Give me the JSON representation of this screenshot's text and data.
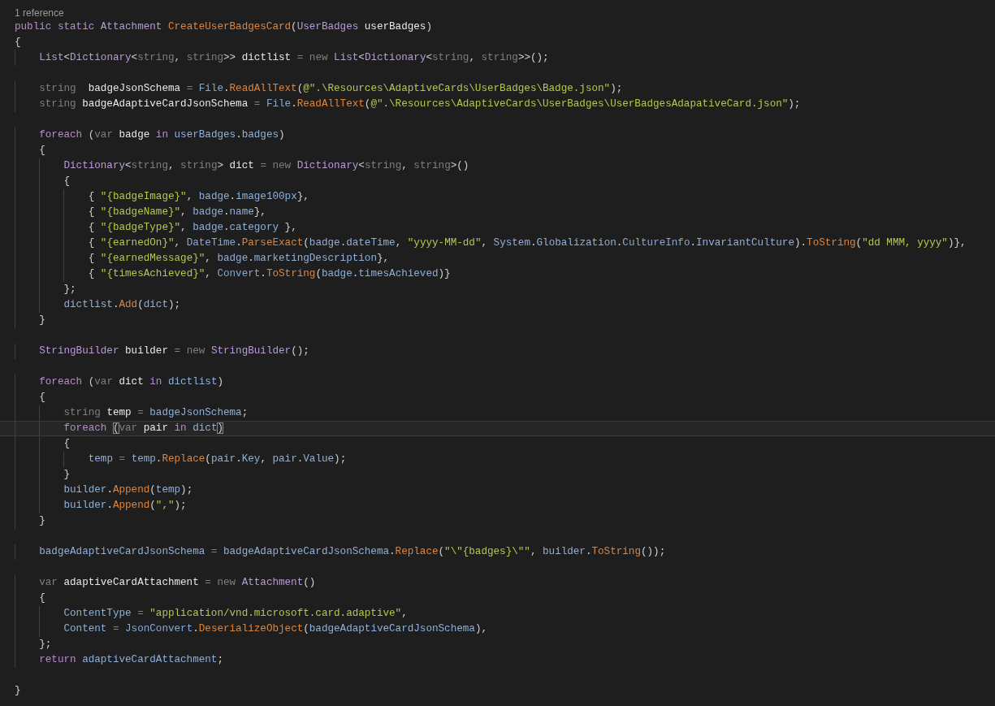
{
  "codelens": "1 reference",
  "lines": [
    {
      "kind": "code",
      "current": false,
      "tokens": [
        {
          "kind": "keyword",
          "text": "public static "
        },
        {
          "kind": "type",
          "text": "Attachment "
        },
        {
          "kind": "method",
          "text": "CreateUserBadgesCard"
        },
        {
          "kind": "punct",
          "text": "("
        },
        {
          "kind": "type",
          "text": "UserBadges "
        },
        {
          "kind": "local",
          "text": "userBadges"
        },
        {
          "kind": "punct",
          "text": ")"
        }
      ]
    },
    {
      "kind": "code",
      "current": false,
      "tokens": [
        {
          "kind": "punct",
          "text": "{"
        }
      ]
    },
    {
      "kind": "code",
      "current": false,
      "tokens": [
        {
          "kind": "type",
          "text": "    List"
        },
        {
          "kind": "punct",
          "text": "<"
        },
        {
          "kind": "type",
          "text": "Dictionary"
        },
        {
          "kind": "punct",
          "text": "<"
        },
        {
          "kind": "dim",
          "text": "string"
        },
        {
          "kind": "punct",
          "text": ", "
        },
        {
          "kind": "dim",
          "text": "string"
        },
        {
          "kind": "punct",
          "text": ">> "
        },
        {
          "kind": "local",
          "text": "dictlist "
        },
        {
          "kind": "dim",
          "text": "= new "
        },
        {
          "kind": "type",
          "text": "List"
        },
        {
          "kind": "punct",
          "text": "<"
        },
        {
          "kind": "type",
          "text": "Dictionary"
        },
        {
          "kind": "punct",
          "text": "<"
        },
        {
          "kind": "dim",
          "text": "string"
        },
        {
          "kind": "punct",
          "text": ", "
        },
        {
          "kind": "dim",
          "text": "string"
        },
        {
          "kind": "punct",
          "text": ">>();"
        }
      ]
    },
    {
      "kind": "blank"
    },
    {
      "kind": "code",
      "current": false,
      "tokens": [
        {
          "kind": "dim",
          "text": "    string  "
        },
        {
          "kind": "local",
          "text": "badgeJsonSchema "
        },
        {
          "kind": "dim",
          "text": "= "
        },
        {
          "kind": "class",
          "text": "File"
        },
        {
          "kind": "punct",
          "text": "."
        },
        {
          "kind": "method",
          "text": "ReadAllText"
        },
        {
          "kind": "punct",
          "text": "("
        },
        {
          "kind": "string",
          "text": "@\".\\Resources\\AdaptiveCards\\UserBadges\\Badge.json\""
        },
        {
          "kind": "punct",
          "text": ");"
        }
      ]
    },
    {
      "kind": "code",
      "current": false,
      "tokens": [
        {
          "kind": "dim",
          "text": "    string "
        },
        {
          "kind": "local",
          "text": "badgeAdaptiveCardJsonSchema "
        },
        {
          "kind": "dim",
          "text": "= "
        },
        {
          "kind": "class",
          "text": "File"
        },
        {
          "kind": "punct",
          "text": "."
        },
        {
          "kind": "method",
          "text": "ReadAllText"
        },
        {
          "kind": "punct",
          "text": "("
        },
        {
          "kind": "string",
          "text": "@\".\\Resources\\AdaptiveCards\\UserBadges\\UserBadgesAdapativeCard.json\""
        },
        {
          "kind": "punct",
          "text": ");"
        }
      ]
    },
    {
      "kind": "blank"
    },
    {
      "kind": "code",
      "current": false,
      "tokens": [
        {
          "kind": "keyword",
          "text": "    foreach "
        },
        {
          "kind": "punct",
          "text": "("
        },
        {
          "kind": "dim",
          "text": "var "
        },
        {
          "kind": "local",
          "text": "badge "
        },
        {
          "kind": "keyword",
          "text": "in "
        },
        {
          "kind": "member",
          "text": "userBadges"
        },
        {
          "kind": "punct",
          "text": "."
        },
        {
          "kind": "member",
          "text": "badges"
        },
        {
          "kind": "punct",
          "text": ")"
        }
      ]
    },
    {
      "kind": "code",
      "current": false,
      "tokens": [
        {
          "kind": "punct",
          "text": "    {"
        }
      ]
    },
    {
      "kind": "code",
      "current": false,
      "tokens": [
        {
          "kind": "type",
          "text": "        Dictionary"
        },
        {
          "kind": "punct",
          "text": "<"
        },
        {
          "kind": "dim",
          "text": "string"
        },
        {
          "kind": "punct",
          "text": ", "
        },
        {
          "kind": "dim",
          "text": "string"
        },
        {
          "kind": "punct",
          "text": "> "
        },
        {
          "kind": "local",
          "text": "dict "
        },
        {
          "kind": "dim",
          "text": "= new "
        },
        {
          "kind": "type",
          "text": "Dictionary"
        },
        {
          "kind": "punct",
          "text": "<"
        },
        {
          "kind": "dim",
          "text": "string"
        },
        {
          "kind": "punct",
          "text": ", "
        },
        {
          "kind": "dim",
          "text": "string"
        },
        {
          "kind": "punct",
          "text": ">()"
        }
      ]
    },
    {
      "kind": "code",
      "current": false,
      "tokens": [
        {
          "kind": "punct",
          "text": "        {"
        }
      ]
    },
    {
      "kind": "code",
      "current": false,
      "tokens": [
        {
          "kind": "punct",
          "text": "            { "
        },
        {
          "kind": "string",
          "text": "\"{badgeImage}\""
        },
        {
          "kind": "punct",
          "text": ", "
        },
        {
          "kind": "member",
          "text": "badge"
        },
        {
          "kind": "punct",
          "text": "."
        },
        {
          "kind": "member",
          "text": "image100px"
        },
        {
          "kind": "punct",
          "text": "},"
        }
      ]
    },
    {
      "kind": "code",
      "current": false,
      "tokens": [
        {
          "kind": "punct",
          "text": "            { "
        },
        {
          "kind": "string",
          "text": "\"{badgeName}\""
        },
        {
          "kind": "punct",
          "text": ", "
        },
        {
          "kind": "member",
          "text": "badge"
        },
        {
          "kind": "punct",
          "text": "."
        },
        {
          "kind": "member",
          "text": "name"
        },
        {
          "kind": "punct",
          "text": "},"
        }
      ]
    },
    {
      "kind": "code",
      "current": false,
      "tokens": [
        {
          "kind": "punct",
          "text": "            { "
        },
        {
          "kind": "string",
          "text": "\"{badgeType}\""
        },
        {
          "kind": "punct",
          "text": ", "
        },
        {
          "kind": "member",
          "text": "badge"
        },
        {
          "kind": "punct",
          "text": "."
        },
        {
          "kind": "member",
          "text": "category "
        },
        {
          "kind": "punct",
          "text": "},"
        }
      ]
    },
    {
      "kind": "code",
      "current": false,
      "tokens": [
        {
          "kind": "punct",
          "text": "            { "
        },
        {
          "kind": "string",
          "text": "\"{earnedOn}\""
        },
        {
          "kind": "punct",
          "text": ", "
        },
        {
          "kind": "class",
          "text": "DateTime"
        },
        {
          "kind": "punct",
          "text": "."
        },
        {
          "kind": "method",
          "text": "ParseExact"
        },
        {
          "kind": "punct",
          "text": "("
        },
        {
          "kind": "member",
          "text": "badge"
        },
        {
          "kind": "punct",
          "text": "."
        },
        {
          "kind": "member",
          "text": "dateTime"
        },
        {
          "kind": "punct",
          "text": ", "
        },
        {
          "kind": "string",
          "text": "\"yyyy-MM-dd\""
        },
        {
          "kind": "punct",
          "text": ", "
        },
        {
          "kind": "member",
          "text": "System"
        },
        {
          "kind": "punct",
          "text": "."
        },
        {
          "kind": "member",
          "text": "Globalization"
        },
        {
          "kind": "punct",
          "text": "."
        },
        {
          "kind": "class",
          "text": "CultureInfo"
        },
        {
          "kind": "punct",
          "text": "."
        },
        {
          "kind": "member",
          "text": "InvariantCulture"
        },
        {
          "kind": "punct",
          "text": ")."
        },
        {
          "kind": "method",
          "text": "ToString"
        },
        {
          "kind": "punct",
          "text": "("
        },
        {
          "kind": "string",
          "text": "\"dd MMM, yyyy\""
        },
        {
          "kind": "punct",
          "text": ")},"
        }
      ]
    },
    {
      "kind": "code",
      "current": false,
      "tokens": [
        {
          "kind": "punct",
          "text": "            { "
        },
        {
          "kind": "string",
          "text": "\"{earnedMessage}\""
        },
        {
          "kind": "punct",
          "text": ", "
        },
        {
          "kind": "member",
          "text": "badge"
        },
        {
          "kind": "punct",
          "text": "."
        },
        {
          "kind": "member",
          "text": "marketingDescription"
        },
        {
          "kind": "punct",
          "text": "},"
        }
      ]
    },
    {
      "kind": "code",
      "current": false,
      "tokens": [
        {
          "kind": "punct",
          "text": "            { "
        },
        {
          "kind": "string",
          "text": "\"{timesAchieved}\""
        },
        {
          "kind": "punct",
          "text": ", "
        },
        {
          "kind": "class",
          "text": "Convert"
        },
        {
          "kind": "punct",
          "text": "."
        },
        {
          "kind": "method",
          "text": "ToString"
        },
        {
          "kind": "punct",
          "text": "("
        },
        {
          "kind": "member",
          "text": "badge"
        },
        {
          "kind": "punct",
          "text": "."
        },
        {
          "kind": "member",
          "text": "timesAchieved"
        },
        {
          "kind": "punct",
          "text": ")}"
        }
      ]
    },
    {
      "kind": "code",
      "current": false,
      "tokens": [
        {
          "kind": "punct",
          "text": "        };"
        }
      ]
    },
    {
      "kind": "code",
      "current": false,
      "tokens": [
        {
          "kind": "member",
          "text": "        dictlist"
        },
        {
          "kind": "punct",
          "text": "."
        },
        {
          "kind": "method",
          "text": "Add"
        },
        {
          "kind": "punct",
          "text": "("
        },
        {
          "kind": "member",
          "text": "dict"
        },
        {
          "kind": "punct",
          "text": ");"
        }
      ]
    },
    {
      "kind": "code",
      "current": false,
      "tokens": [
        {
          "kind": "punct",
          "text": "    }"
        }
      ]
    },
    {
      "kind": "blank"
    },
    {
      "kind": "code",
      "current": false,
      "tokens": [
        {
          "kind": "type",
          "text": "    StringBuilder "
        },
        {
          "kind": "local",
          "text": "builder "
        },
        {
          "kind": "dim",
          "text": "= new "
        },
        {
          "kind": "type",
          "text": "StringBuilder"
        },
        {
          "kind": "punct",
          "text": "();"
        }
      ]
    },
    {
      "kind": "blank"
    },
    {
      "kind": "code",
      "current": false,
      "tokens": [
        {
          "kind": "keyword",
          "text": "    foreach "
        },
        {
          "kind": "punct",
          "text": "("
        },
        {
          "kind": "dim",
          "text": "var "
        },
        {
          "kind": "local",
          "text": "dict "
        },
        {
          "kind": "keyword",
          "text": "in "
        },
        {
          "kind": "member",
          "text": "dictlist"
        },
        {
          "kind": "punct",
          "text": ")"
        }
      ]
    },
    {
      "kind": "code",
      "current": false,
      "tokens": [
        {
          "kind": "punct",
          "text": "    {"
        }
      ]
    },
    {
      "kind": "code",
      "current": false,
      "tokens": [
        {
          "kind": "dim",
          "text": "        string "
        },
        {
          "kind": "local",
          "text": "temp "
        },
        {
          "kind": "dim",
          "text": "= "
        },
        {
          "kind": "member",
          "text": "badgeJsonSchema"
        },
        {
          "kind": "punct",
          "text": ";"
        }
      ]
    },
    {
      "kind": "code",
      "current": true,
      "tokens": [
        {
          "kind": "keyword",
          "text": "        foreach "
        },
        {
          "kind": "bracket",
          "text": "("
        },
        {
          "kind": "dim",
          "text": "var "
        },
        {
          "kind": "local",
          "text": "pair "
        },
        {
          "kind": "keyword",
          "text": "in "
        },
        {
          "kind": "member",
          "text": "dict"
        },
        {
          "kind": "bracket",
          "text": ")"
        }
      ]
    },
    {
      "kind": "code",
      "current": false,
      "tokens": [
        {
          "kind": "punct",
          "text": "        {"
        }
      ]
    },
    {
      "kind": "code",
      "current": false,
      "tokens": [
        {
          "kind": "member",
          "text": "            temp "
        },
        {
          "kind": "dim",
          "text": "= "
        },
        {
          "kind": "member",
          "text": "temp"
        },
        {
          "kind": "punct",
          "text": "."
        },
        {
          "kind": "method",
          "text": "Replace"
        },
        {
          "kind": "punct",
          "text": "("
        },
        {
          "kind": "member",
          "text": "pair"
        },
        {
          "kind": "punct",
          "text": "."
        },
        {
          "kind": "member",
          "text": "Key"
        },
        {
          "kind": "punct",
          "text": ", "
        },
        {
          "kind": "member",
          "text": "pair"
        },
        {
          "kind": "punct",
          "text": "."
        },
        {
          "kind": "member",
          "text": "Value"
        },
        {
          "kind": "punct",
          "text": ");"
        }
      ]
    },
    {
      "kind": "code",
      "current": false,
      "tokens": [
        {
          "kind": "punct",
          "text": "        }"
        }
      ]
    },
    {
      "kind": "code",
      "current": false,
      "tokens": [
        {
          "kind": "member",
          "text": "        builder"
        },
        {
          "kind": "punct",
          "text": "."
        },
        {
          "kind": "method",
          "text": "Append"
        },
        {
          "kind": "punct",
          "text": "("
        },
        {
          "kind": "member",
          "text": "temp"
        },
        {
          "kind": "punct",
          "text": ");"
        }
      ]
    },
    {
      "kind": "code",
      "current": false,
      "tokens": [
        {
          "kind": "member",
          "text": "        builder"
        },
        {
          "kind": "punct",
          "text": "."
        },
        {
          "kind": "method",
          "text": "Append"
        },
        {
          "kind": "punct",
          "text": "("
        },
        {
          "kind": "string",
          "text": "\",\""
        },
        {
          "kind": "punct",
          "text": ");"
        }
      ]
    },
    {
      "kind": "code",
      "current": false,
      "tokens": [
        {
          "kind": "punct",
          "text": "    }"
        }
      ]
    },
    {
      "kind": "blank"
    },
    {
      "kind": "code",
      "current": false,
      "tokens": [
        {
          "kind": "member",
          "text": "    badgeAdaptiveCardJsonSchema "
        },
        {
          "kind": "dim",
          "text": "= "
        },
        {
          "kind": "member",
          "text": "badgeAdaptiveCardJsonSchema"
        },
        {
          "kind": "punct",
          "text": "."
        },
        {
          "kind": "method",
          "text": "Replace"
        },
        {
          "kind": "punct",
          "text": "("
        },
        {
          "kind": "string",
          "text": "\"\\\"{badges}\\\"\""
        },
        {
          "kind": "punct",
          "text": ", "
        },
        {
          "kind": "member",
          "text": "builder"
        },
        {
          "kind": "punct",
          "text": "."
        },
        {
          "kind": "method",
          "text": "ToString"
        },
        {
          "kind": "punct",
          "text": "());"
        }
      ]
    },
    {
      "kind": "blank"
    },
    {
      "kind": "code",
      "current": false,
      "tokens": [
        {
          "kind": "dim",
          "text": "    var "
        },
        {
          "kind": "local",
          "text": "adaptiveCardAttachment "
        },
        {
          "kind": "dim",
          "text": "= new "
        },
        {
          "kind": "type",
          "text": "Attachment"
        },
        {
          "kind": "punct",
          "text": "()"
        }
      ]
    },
    {
      "kind": "code",
      "current": false,
      "tokens": [
        {
          "kind": "punct",
          "text": "    {"
        }
      ]
    },
    {
      "kind": "code",
      "current": false,
      "tokens": [
        {
          "kind": "member",
          "text": "        ContentType "
        },
        {
          "kind": "dim",
          "text": "= "
        },
        {
          "kind": "string",
          "text": "\"application/vnd.microsoft.card.adaptive\""
        },
        {
          "kind": "punct",
          "text": ","
        }
      ]
    },
    {
      "kind": "code",
      "current": false,
      "tokens": [
        {
          "kind": "member",
          "text": "        Content "
        },
        {
          "kind": "dim",
          "text": "= "
        },
        {
          "kind": "class",
          "text": "JsonConvert"
        },
        {
          "kind": "punct",
          "text": "."
        },
        {
          "kind": "method",
          "text": "DeserializeObject"
        },
        {
          "kind": "punct",
          "text": "("
        },
        {
          "kind": "member",
          "text": "badgeAdaptiveCardJsonSchema"
        },
        {
          "kind": "punct",
          "text": "),"
        }
      ]
    },
    {
      "kind": "code",
      "current": false,
      "tokens": [
        {
          "kind": "punct",
          "text": "    };"
        }
      ]
    },
    {
      "kind": "code",
      "current": false,
      "tokens": [
        {
          "kind": "keyword",
          "text": "    return "
        },
        {
          "kind": "member",
          "text": "adaptiveCardAttachment"
        },
        {
          "kind": "punct",
          "text": ";"
        }
      ]
    },
    {
      "kind": "blank"
    },
    {
      "kind": "code",
      "current": false,
      "tokens": [
        {
          "kind": "punct",
          "text": "}"
        }
      ]
    }
  ]
}
